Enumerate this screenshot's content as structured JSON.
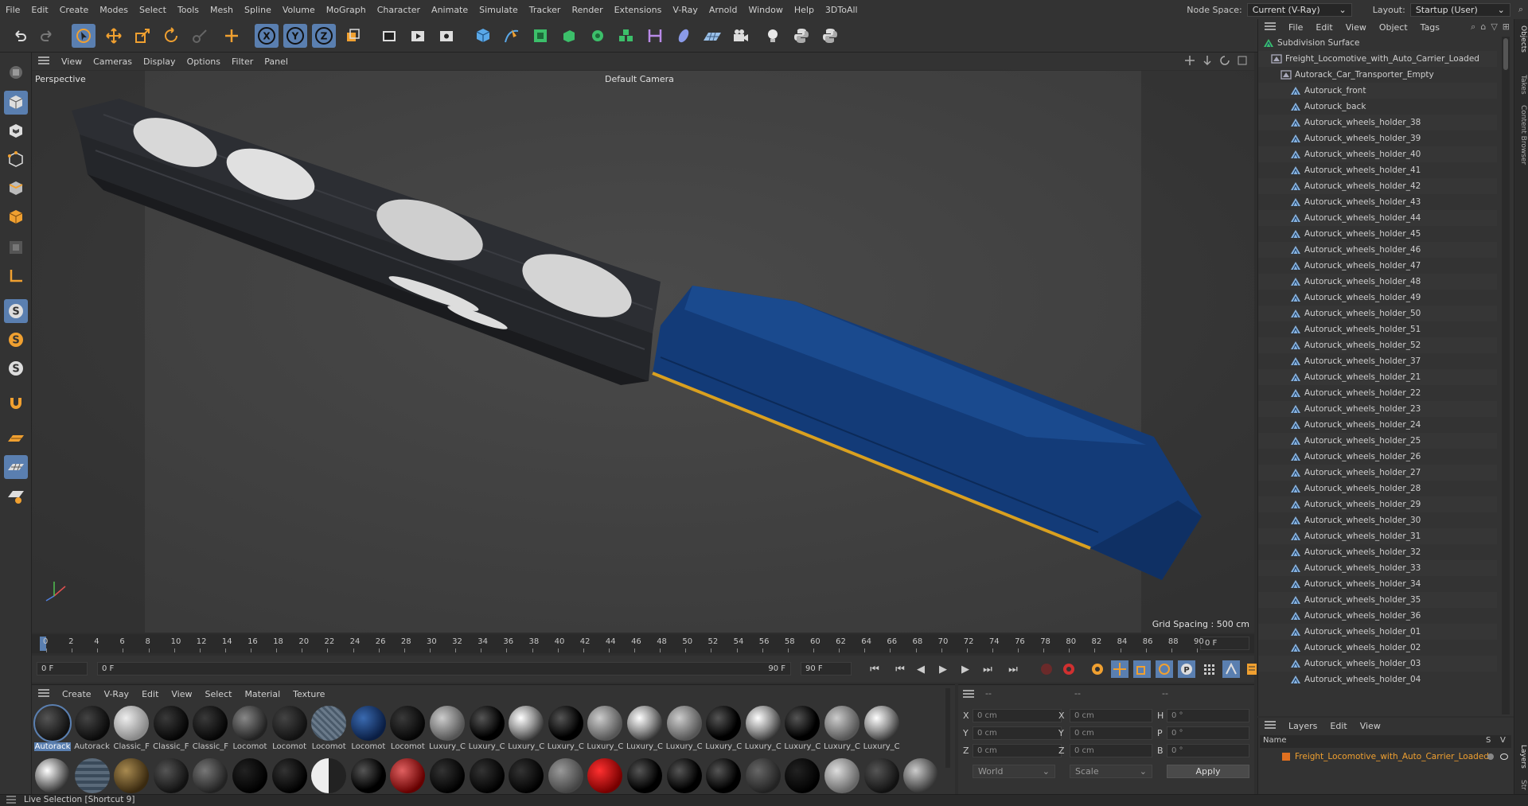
{
  "menubar": {
    "items": [
      "File",
      "Edit",
      "Create",
      "Modes",
      "Select",
      "Tools",
      "Mesh",
      "Spline",
      "Volume",
      "MoGraph",
      "Character",
      "Animate",
      "Simulate",
      "Tracker",
      "Render",
      "Extensions",
      "V-Ray",
      "Arnold",
      "Window",
      "Help",
      "3DToAll"
    ],
    "node_space_label": "Node Space:",
    "node_space_value": "Current (V-Ray)",
    "layout_label": "Layout:",
    "layout_value": "Startup (User)"
  },
  "toolbar": {
    "icons": [
      "undo-icon",
      "redo-icon",
      "live-selection-icon",
      "move-icon",
      "scale-icon",
      "rotate-icon",
      "recent-tool-icon",
      "world-axis-icon",
      "x-axis-icon",
      "y-axis-icon",
      "z-axis-icon",
      "coordinate-system-icon",
      "render-region-icon",
      "render-view-icon",
      "render-settings-icon",
      "cube-icon",
      "pen-icon",
      "subdivision-icon",
      "extrude-icon",
      "array-icon",
      "mograph-icon",
      "deformer-icon",
      "field-icon",
      "floor-icon",
      "camera-icon",
      "light-icon",
      "python-icon",
      "python-alt-icon"
    ],
    "axis_x": "X",
    "axis_y": "Y",
    "axis_z": "Z"
  },
  "viewport_menu": {
    "items": [
      "View",
      "Cameras",
      "Display",
      "Options",
      "Filter",
      "Panel"
    ],
    "view_name": "Perspective",
    "camera_name": "Default Camera",
    "grid_spacing": "Grid Spacing : 500 cm"
  },
  "timeline": {
    "ticks": [
      "0",
      "2",
      "4",
      "6",
      "8",
      "10",
      "12",
      "14",
      "16",
      "18",
      "20",
      "22",
      "24",
      "26",
      "28",
      "30",
      "32",
      "34",
      "36",
      "38",
      "40",
      "42",
      "44",
      "46",
      "48",
      "50",
      "52",
      "54",
      "56",
      "58",
      "60",
      "62",
      "64",
      "66",
      "68",
      "70",
      "72",
      "74",
      "76",
      "78",
      "80",
      "82",
      "84",
      "86",
      "88",
      "90"
    ],
    "current_frame": "0 F"
  },
  "transport": {
    "start_frame": "0 F",
    "range_start": "0 F",
    "range_end": "90 F",
    "end_frame": "90 F"
  },
  "material_panel": {
    "menu": [
      "Create",
      "V-Ray",
      "Edit",
      "View",
      "Select",
      "Material",
      "Texture"
    ],
    "row1_labels": [
      "Autorack",
      "Autorack",
      "Classic_F",
      "Classic_F",
      "Classic_F",
      "Locomot",
      "Locomot",
      "Locomot",
      "Locomot",
      "Locomot",
      "Luxury_C",
      "Luxury_C",
      "Luxury_C",
      "Luxury_C",
      "Luxury_C",
      "Luxury_C",
      "Luxury_C",
      "Luxury_C",
      "Luxury_C",
      "Luxury_C",
      "Luxury_C",
      "Luxury_C"
    ]
  },
  "attributes": {
    "header": [
      "--",
      "--",
      "--"
    ],
    "rows": [
      {
        "a": "X",
        "av": "0 cm",
        "b": "X",
        "bv": "0 cm",
        "c": "H",
        "cv": "0 °"
      },
      {
        "a": "Y",
        "av": "0 cm",
        "b": "Y",
        "bv": "0 cm",
        "c": "P",
        "cv": "0 °"
      },
      {
        "a": "Z",
        "av": "0 cm",
        "b": "Z",
        "bv": "0 cm",
        "c": "B",
        "cv": "0 °"
      }
    ],
    "coord_mode": "World",
    "size_mode": "Scale",
    "apply_label": "Apply"
  },
  "objects_panel": {
    "menu": [
      "File",
      "Edit",
      "View",
      "Object",
      "Tags"
    ],
    "root": "Subdivision Surface",
    "group": "Freight_Locomotive_with_Auto_Carrier_Loaded",
    "subgroup": "Autorack_Car_Transporter_Empty",
    "items": [
      "Autoruck_front",
      "Autoruck_back",
      "Autoruck_wheels_holder_38",
      "Autoruck_wheels_holder_39",
      "Autoruck_wheels_holder_40",
      "Autoruck_wheels_holder_41",
      "Autoruck_wheels_holder_42",
      "Autoruck_wheels_holder_43",
      "Autoruck_wheels_holder_44",
      "Autoruck_wheels_holder_45",
      "Autoruck_wheels_holder_46",
      "Autoruck_wheels_holder_47",
      "Autoruck_wheels_holder_48",
      "Autoruck_wheels_holder_49",
      "Autoruck_wheels_holder_50",
      "Autoruck_wheels_holder_51",
      "Autoruck_wheels_holder_52",
      "Autoruck_wheels_holder_37",
      "Autoruck_wheels_holder_21",
      "Autoruck_wheels_holder_22",
      "Autoruck_wheels_holder_23",
      "Autoruck_wheels_holder_24",
      "Autoruck_wheels_holder_25",
      "Autoruck_wheels_holder_26",
      "Autoruck_wheels_holder_27",
      "Autoruck_wheels_holder_28",
      "Autoruck_wheels_holder_29",
      "Autoruck_wheels_holder_30",
      "Autoruck_wheels_holder_31",
      "Autoruck_wheels_holder_32",
      "Autoruck_wheels_holder_33",
      "Autoruck_wheels_holder_34",
      "Autoruck_wheels_holder_35",
      "Autoruck_wheels_holder_36",
      "Autoruck_wheels_holder_01",
      "Autoruck_wheels_holder_02",
      "Autoruck_wheels_holder_03",
      "Autoruck_wheels_holder_04"
    ]
  },
  "layers_panel": {
    "menu": [
      "Layers",
      "Edit",
      "View"
    ],
    "col_name": "Name",
    "col_s": "S",
    "col_v": "V",
    "layer_name": "Freight_Locomotive_with_Auto_Carrier_Loaded",
    "layer_color": "#e07020"
  },
  "right_tabs": [
    "Objects",
    "Takes",
    "Content Browser",
    "Layers",
    "Str"
  ],
  "status": "Live Selection [Shortcut 9]",
  "colors": {
    "accent": "#f0a030",
    "selected": "#5a7fb0",
    "locomotive": "#123a78"
  }
}
